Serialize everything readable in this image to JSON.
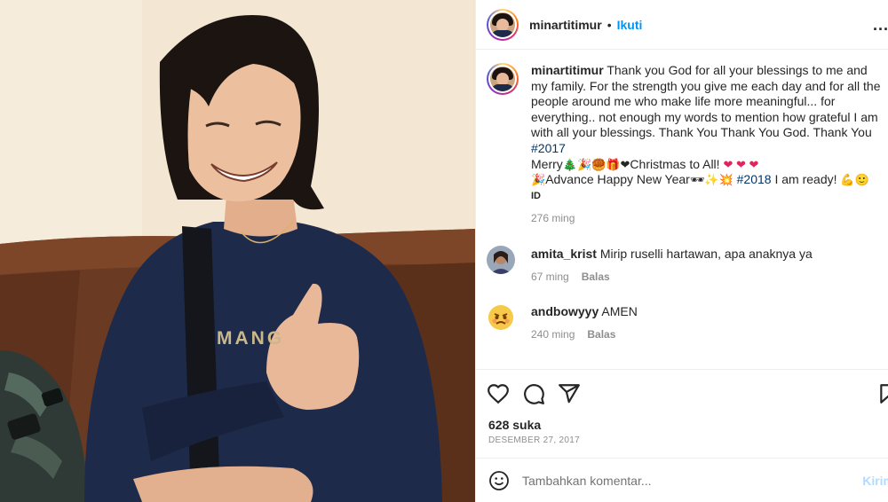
{
  "header": {
    "username": "minartitimur",
    "separator": "•",
    "follow_label": "Ikuti",
    "more_label": "..."
  },
  "caption": {
    "username": "minartitimur",
    "text": "Thank you God for all your blessings to me and my family. For the strength you give me each day and for all the people around me who make life more meaningful... for everything.. not enough my words to mention how grateful I am with all your blessings. Thank You Thank You God. Thank You",
    "hashtag_1": "#2017",
    "line2_merry": "Merry",
    "line2_emojis": "🎄🎉🥮🎁❤",
    "line2_rest": "Christmas to All!",
    "line2_hearts": "❤ ❤ ❤",
    "line3_emoji_start": "🎉",
    "line3_text": "Advance Happy New Year",
    "line3_emojis": "🕶✨💥",
    "hashtag_2": "#2018",
    "line3_tail": "I am ready!",
    "line3_end_emojis": "💪🙂",
    "id_label": "ID",
    "time": "276 ming"
  },
  "comments": [
    {
      "username": "amita_krist",
      "text": "Mirip ruselli hartawan, apa anaknya ya",
      "time": "67 ming",
      "reply_label": "Balas"
    },
    {
      "username": "andbowyyy",
      "text": "AMEN",
      "time": "240 ming",
      "reply_label": "Balas"
    }
  ],
  "actions": {
    "like_icon": "heart-icon",
    "comment_icon": "comment-bubble-icon",
    "share_icon": "paper-plane-icon",
    "save_icon": "bookmark-icon"
  },
  "likes_label": "628 suka",
  "date_label": "DESEMBER 27, 2017",
  "add_comment": {
    "emoji_icon": "smiley-icon",
    "placeholder": "Tambahkan komentar...",
    "post_label": "Kirim"
  },
  "photo": {
    "shirt_text": "MANG"
  },
  "colors": {
    "accent_blue": "#0095f6",
    "hashtag_blue": "#00376b",
    "muted_gray": "#8e8e8e",
    "divider": "#efefef",
    "shirt_navy": "#1e2a4a",
    "sofa_brown": "#6b3a22"
  }
}
